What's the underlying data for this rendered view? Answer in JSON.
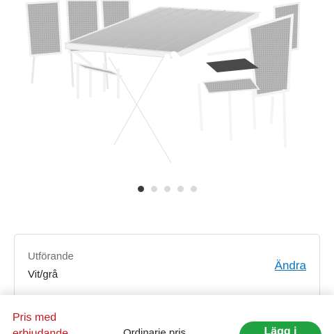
{
  "product_image": {
    "alt": "Table with chairs"
  },
  "carousel": {
    "count": 5,
    "active_index": 0
  },
  "variant": {
    "label": "Utförande",
    "value": "Vit/grå",
    "change_label": "Ändra"
  },
  "bottom_bar": {
    "promo_line1": "Pris med",
    "promo_line2": "erbjudande",
    "ordinary_label": "Ordinarie pris",
    "cta_label": "Lägg i"
  },
  "colors": {
    "promo": "#c4161c",
    "link": "#0a74c2",
    "cta": "#21a341"
  }
}
